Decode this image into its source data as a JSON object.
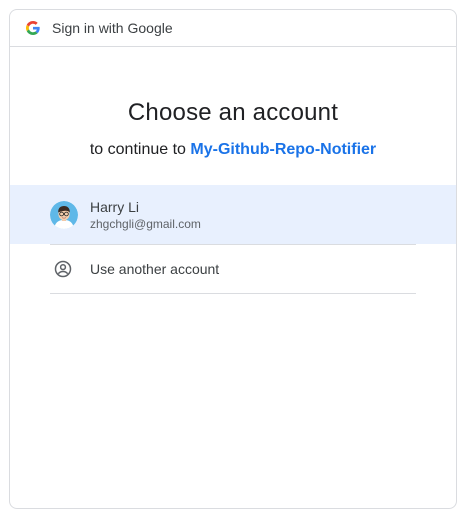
{
  "header": {
    "logo_icon": "google-g-icon",
    "title": "Sign in with Google"
  },
  "main": {
    "title": "Choose an account",
    "subtitle_prefix": "to continue to",
    "app_name": "My-Github-Repo-Notifier"
  },
  "accounts": [
    {
      "name": "Harry Li",
      "email": "zhgchgli@gmail.com",
      "avatar_icon": "avatar-icon",
      "selected": true
    }
  ],
  "other_account": {
    "label": "Use another account",
    "icon": "person-circle-icon"
  },
  "colors": {
    "accent": "#1a73e8",
    "selected_row_bg": "#e8f0fe",
    "border": "#dadce0",
    "text_primary": "#202124",
    "text_secondary": "#5f6368"
  }
}
